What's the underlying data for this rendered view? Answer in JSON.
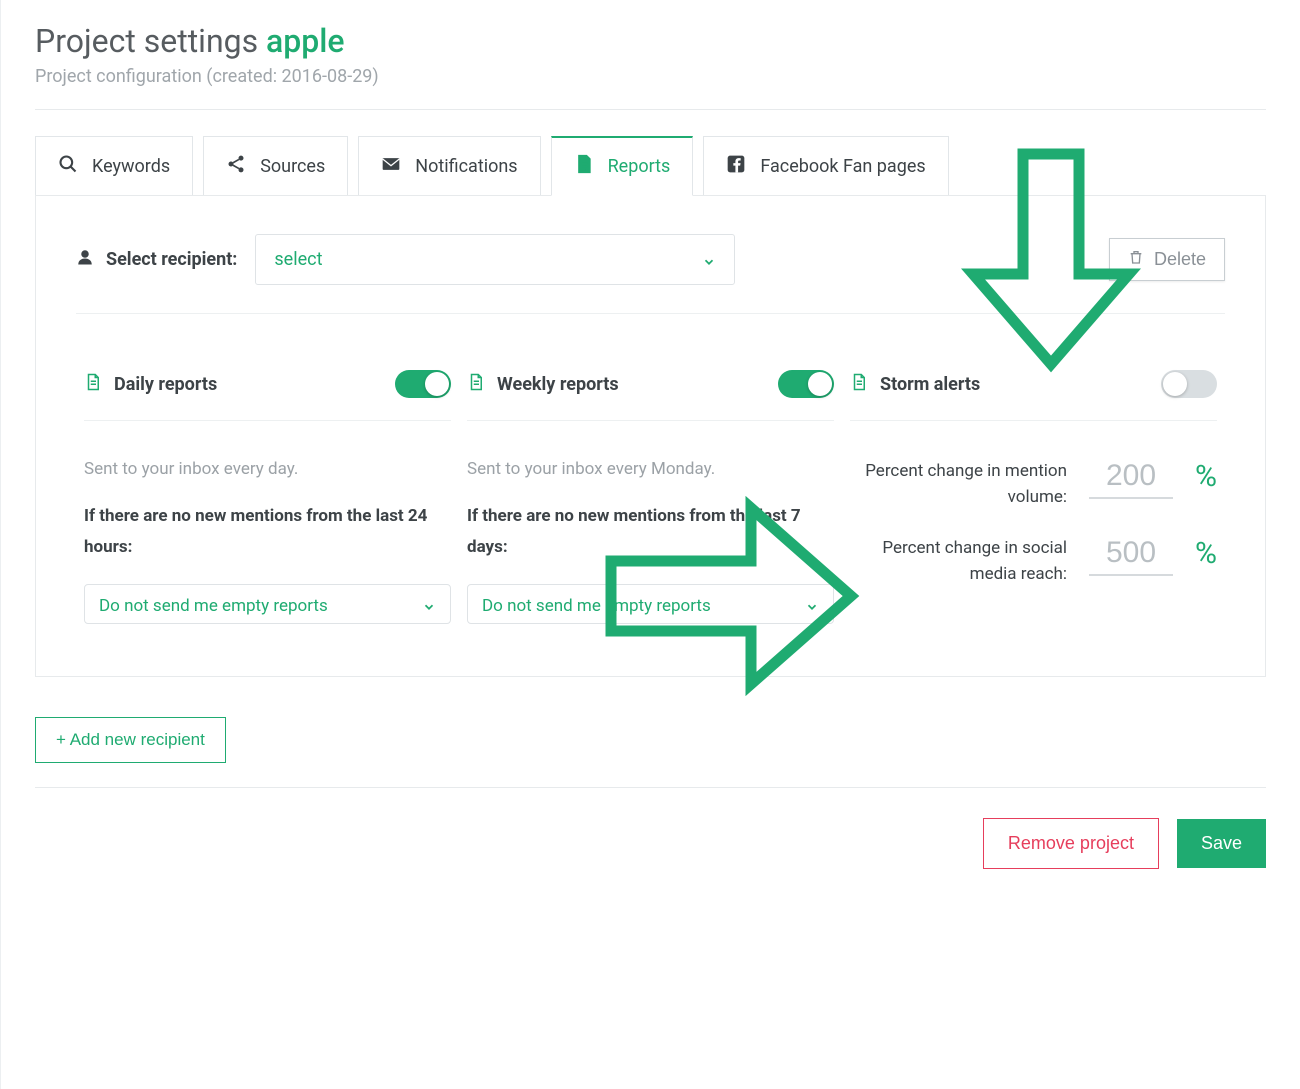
{
  "header": {
    "title_prefix": "Project settings",
    "title_accent": "apple",
    "subtitle": "Project configuration (created: 2016-08-29)"
  },
  "tabs": {
    "keywords": "Keywords",
    "sources": "Sources",
    "notifications": "Notifications",
    "reports": "Reports",
    "facebook": "Facebook Fan pages"
  },
  "recipient": {
    "label": "Select recipient:",
    "select_placeholder": "select",
    "delete_label": "Delete"
  },
  "daily": {
    "title": "Daily reports",
    "toggle_on": true,
    "desc": "Sent to your inbox every day.",
    "cond": "If there are no new mentions from the last 24 hours:",
    "dropdown": "Do not send me empty reports"
  },
  "weekly": {
    "title": "Weekly reports",
    "toggle_on": true,
    "desc": "Sent to your inbox every Monday.",
    "cond": "If there are no new mentions from the last 7 days:",
    "dropdown": "Do not send me empty reports"
  },
  "storm": {
    "title": "Storm alerts",
    "toggle_on": false,
    "mention_label": "Percent change in mention volume:",
    "mention_value": "200",
    "reach_label": "Percent change in social media reach:",
    "reach_value": "500",
    "pct": "%"
  },
  "footer": {
    "add": "+ Add new recipient",
    "remove": "Remove project",
    "save": "Save"
  },
  "colors": {
    "accent": "#1fab71",
    "danger": "#e63e5c"
  }
}
